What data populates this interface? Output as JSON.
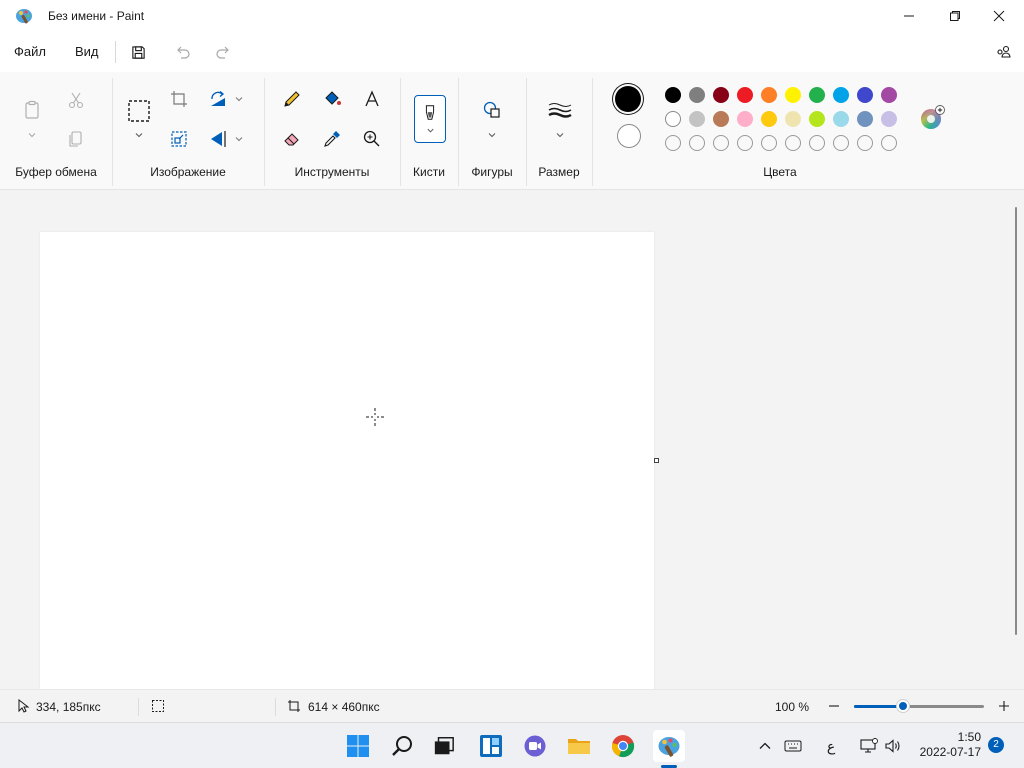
{
  "window": {
    "title": "Без имени - Paint"
  },
  "menu": {
    "file": "Файл",
    "view": "Вид"
  },
  "ribbon": {
    "groups": {
      "clipboard": "Буфер обмена",
      "image": "Изображение",
      "tools": "Инструменты",
      "brushes": "Кисти",
      "shapes": "Фигуры",
      "size": "Размер",
      "colors": "Цвета"
    },
    "active_color": "#000000",
    "secondary_color": "#ffffff",
    "palette_row1": [
      "#000000",
      "#7f7f7f",
      "#880015",
      "#ed1c24",
      "#ff7f27",
      "#fff200",
      "#22b14c",
      "#00a2e8",
      "#3f48cc",
      "#a349a4"
    ],
    "palette_row2": [
      "#ffffff",
      "#c3c3c3",
      "#b97a57",
      "#ffaec9",
      "#ffc90e",
      "#efe4b0",
      "#b5e61d",
      "#99d9ea",
      "#7092be",
      "#c8bfe7"
    ],
    "palette_row3_empty_count": 10
  },
  "status": {
    "cursor_position": "334, 185пкс",
    "canvas_size": "614 × 460пкс",
    "zoom": "100 %",
    "zoom_level_fraction": 0.38
  },
  "taskbar": {
    "ime_indicator": "ع",
    "time": "1:50",
    "date": "2022-07-17",
    "notifications": "2"
  }
}
